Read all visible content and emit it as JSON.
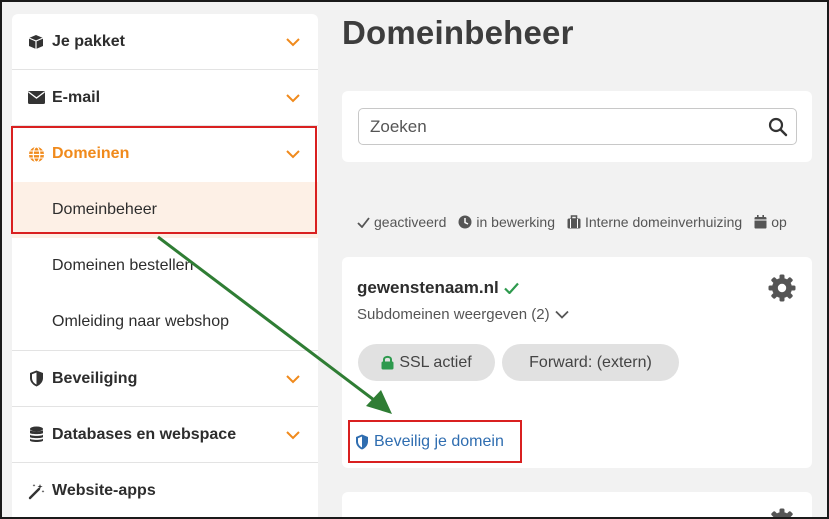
{
  "sidebar": {
    "items": [
      {
        "label": "Je pakket",
        "icon": "package-icon"
      },
      {
        "label": "E-mail",
        "icon": "envelope-icon"
      },
      {
        "label": "Domeinen",
        "icon": "globe-icon",
        "active": true,
        "sub_items": [
          {
            "label": "Domeinbeheer",
            "selected": true
          },
          {
            "label": "Domeinen bestellen"
          },
          {
            "label": "Omleiding naar webshop"
          }
        ]
      },
      {
        "label": "Beveiliging",
        "icon": "shield-icon"
      },
      {
        "label": "Databases en webspace",
        "icon": "database-icon"
      },
      {
        "label": "Website-apps",
        "icon": "magic-wand-icon"
      }
    ]
  },
  "main": {
    "title": "Domeinbeheer",
    "search": {
      "placeholder": "Zoeken",
      "value": ""
    },
    "legend": [
      {
        "label": "geactiveerd",
        "icon": "check-icon"
      },
      {
        "label": "in bewerking",
        "icon": "clock-icon"
      },
      {
        "label": "Interne domeinverhuizing",
        "icon": "suitcase-icon"
      },
      {
        "label": "op",
        "icon": "calendar-icon"
      }
    ],
    "domain_card": {
      "domain": "gewenstenaam.nl",
      "subdomains_label": "Subdomeinen weergeven (2)",
      "ssl_label": "SSL actief",
      "forward_label": "Forward: (extern)",
      "secure_link": "Beveilig je domein"
    }
  },
  "colors": {
    "accent_orange": "#f08a1c",
    "selected_bg": "#fdf0e6",
    "link_blue": "#2f6db0",
    "success_green": "#2e9a4e",
    "highlight_red": "#d92020",
    "arrow_green": "#2f7d34"
  }
}
